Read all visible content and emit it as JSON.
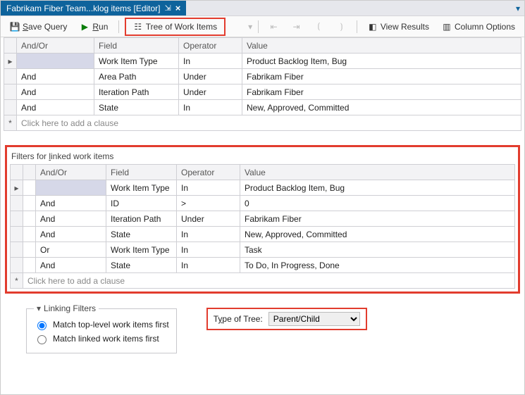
{
  "tab": {
    "title": "Fabrikam Fiber Team...klog items [Editor]",
    "pin_glyph": "⇲",
    "close_glyph": "×"
  },
  "toolbar": {
    "save_label": "Save Query",
    "run_label": "Run",
    "tree_label": "Tree of Work Items",
    "view_results_label": "View Results",
    "column_options_label": "Column Options"
  },
  "query": {
    "headers": {
      "andor": "And/Or",
      "field": "Field",
      "operator": "Operator",
      "value": "Value"
    },
    "rows": [
      {
        "marker": "▸",
        "andor": "",
        "field": "Work Item Type",
        "op": "In",
        "value": "Product Backlog Item, Bug",
        "sel": true
      },
      {
        "marker": "",
        "andor": "And",
        "field": "Area Path",
        "op": "Under",
        "value": "Fabrikam Fiber"
      },
      {
        "marker": "",
        "andor": "And",
        "field": "Iteration Path",
        "op": "Under",
        "value": "Fabrikam Fiber"
      },
      {
        "marker": "",
        "andor": "And",
        "field": "State",
        "op": "In",
        "value": "New, Approved, Committed"
      }
    ],
    "add_clause": "Click here to add a clause"
  },
  "linked": {
    "title": "Filters for linked work items",
    "rows": [
      {
        "marker": "▸",
        "andor": "",
        "field": "Work Item Type",
        "op": "In",
        "value": "Product Backlog Item, Bug",
        "sel": true
      },
      {
        "marker": "",
        "andor": "And",
        "field": "ID",
        "op": ">",
        "value": "0"
      },
      {
        "marker": "",
        "andor": "And",
        "field": "Iteration Path",
        "op": "Under",
        "value": "Fabrikam Fiber"
      },
      {
        "marker": "",
        "andor": "And",
        "field": "State",
        "op": "In",
        "value": "New, Approved, Committed"
      },
      {
        "marker": "",
        "andor": "Or",
        "field": "Work Item Type",
        "op": "In",
        "value": "Task"
      },
      {
        "marker": "",
        "andor": "And",
        "field": "State",
        "op": "In",
        "value": "To Do, In Progress, Done"
      }
    ],
    "add_clause": "Click here to add a clause"
  },
  "linking": {
    "legend": "Linking Filters",
    "opt_top": "Match top-level work items first",
    "opt_linked": "Match linked work items first",
    "tree_label": "Type of Tree:",
    "tree_value": "Parent/Child"
  },
  "col_widths": {
    "main": {
      "rh": 18,
      "andor": 110,
      "field": 120,
      "op": 90
    },
    "linked": {
      "rh1": 18,
      "rh2": 18,
      "andor": 100,
      "field": 100,
      "op": 90
    }
  }
}
